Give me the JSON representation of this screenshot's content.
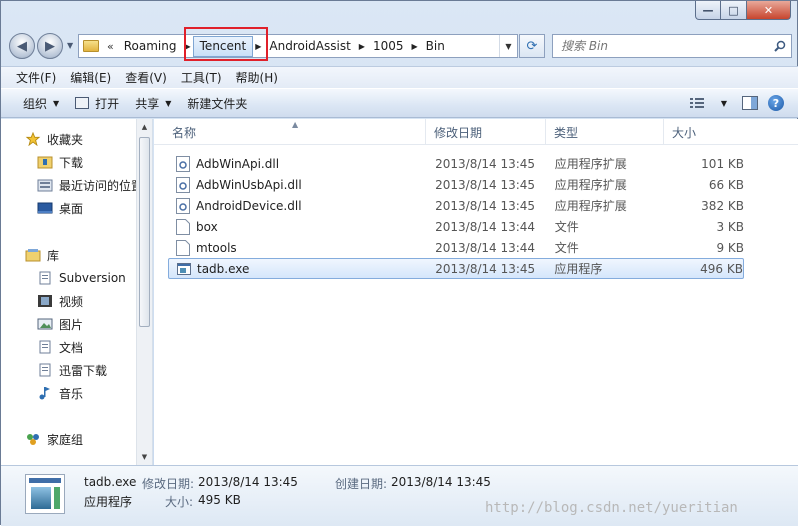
{
  "window": {
    "min_glyph": "—",
    "max_glyph": "□",
    "close_glyph": "✕"
  },
  "address": {
    "chevrons": "«",
    "crumbs": [
      "Roaming",
      "Tencent",
      "AndroidAssist",
      "1005",
      "Bin"
    ]
  },
  "search": {
    "placeholder": "搜索 Bin"
  },
  "menu": [
    "文件(F)",
    "编辑(E)",
    "查看(V)",
    "工具(T)",
    "帮助(H)"
  ],
  "toolbar": {
    "organize": "组织",
    "open": "打开",
    "share": "共享",
    "new_folder": "新建文件夹",
    "help": "?"
  },
  "nav": {
    "items": [
      {
        "label": "收藏夹",
        "icon": "star-icon"
      },
      {
        "label": "下载",
        "icon": "download-folder-icon"
      },
      {
        "label": "最近访问的位置",
        "icon": "recent-places-icon"
      },
      {
        "label": "桌面",
        "icon": "desktop-icon"
      },
      {
        "label": "库",
        "icon": "library-icon"
      },
      {
        "label": "Subversion",
        "icon": "document-library-icon"
      },
      {
        "label": "视频",
        "icon": "video-icon"
      },
      {
        "label": "图片",
        "icon": "picture-icon"
      },
      {
        "label": "文档",
        "icon": "document-icon"
      },
      {
        "label": "迅雷下载",
        "icon": "document-icon"
      },
      {
        "label": "音乐",
        "icon": "music-icon"
      },
      {
        "label": "家庭组",
        "icon": "homegroup-icon"
      }
    ]
  },
  "columns": {
    "name": "名称",
    "date": "修改日期",
    "type": "类型",
    "size": "大小"
  },
  "files": [
    {
      "name": "AdbWinApi.dll",
      "date": "2013/8/14 13:45",
      "type": "应用程序扩展",
      "size": "101 KB",
      "icon": "dll-icon"
    },
    {
      "name": "AdbWinUsbApi.dll",
      "date": "2013/8/14 13:45",
      "type": "应用程序扩展",
      "size": "66 KB",
      "icon": "dll-icon"
    },
    {
      "name": "AndroidDevice.dll",
      "date": "2013/8/14 13:45",
      "type": "应用程序扩展",
      "size": "382 KB",
      "icon": "dll-icon"
    },
    {
      "name": "box",
      "date": "2013/8/14 13:44",
      "type": "文件",
      "size": "3 KB",
      "icon": "file-icon"
    },
    {
      "name": "mtools",
      "date": "2013/8/14 13:44",
      "type": "文件",
      "size": "9 KB",
      "icon": "file-icon"
    },
    {
      "name": "tadb.exe",
      "date": "2013/8/14 13:45",
      "type": "应用程序",
      "size": "496 KB",
      "icon": "exe-icon"
    }
  ],
  "details": {
    "name": "tadb.exe",
    "type": "应用程序",
    "modified_label": "修改日期:",
    "modified_value": "2013/8/14 13:45",
    "created_label": "创建日期:",
    "created_value": "2013/8/14 13:45",
    "size_label": "大小:",
    "size_value": "495 KB"
  },
  "watermark": "http://blog.csdn.net/yueritian"
}
